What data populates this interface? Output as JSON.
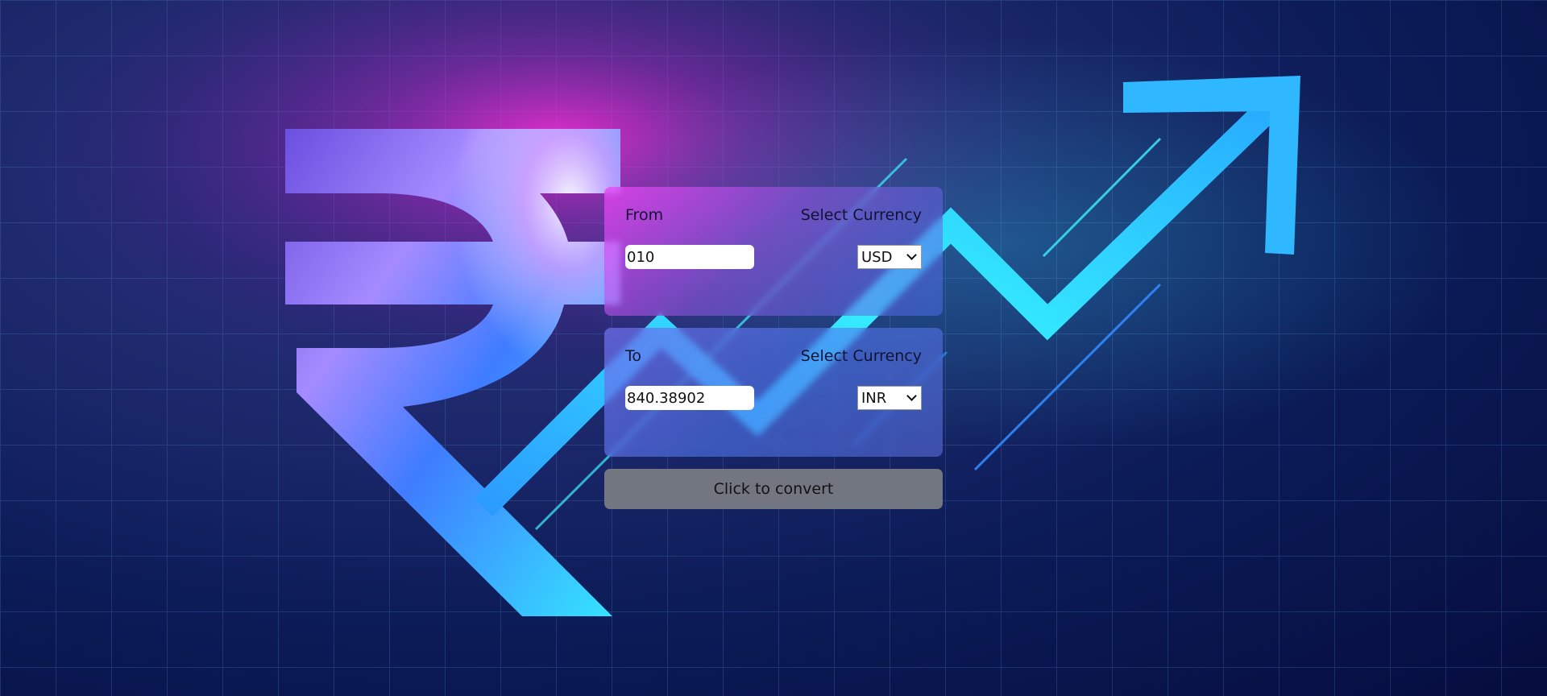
{
  "colors": {
    "accent_pink": "#ff3ce8",
    "accent_cyan": "#2ff2ff",
    "accent_blue": "#2f8bff",
    "background_deep": "#071346",
    "button_gray": "#727680"
  },
  "icons": {
    "background_symbol": "rupee-icon",
    "background_arrow": "trend-up-arrow-icon",
    "select_caret": "chevron-down-icon"
  },
  "converter": {
    "from": {
      "label": "From",
      "select_label": "Select Currency",
      "amount": "010",
      "currency": "USD"
    },
    "to": {
      "label": "To",
      "select_label": "Select Currency",
      "amount": "840.38902",
      "currency": "INR"
    },
    "convert_label": "Click to convert"
  }
}
